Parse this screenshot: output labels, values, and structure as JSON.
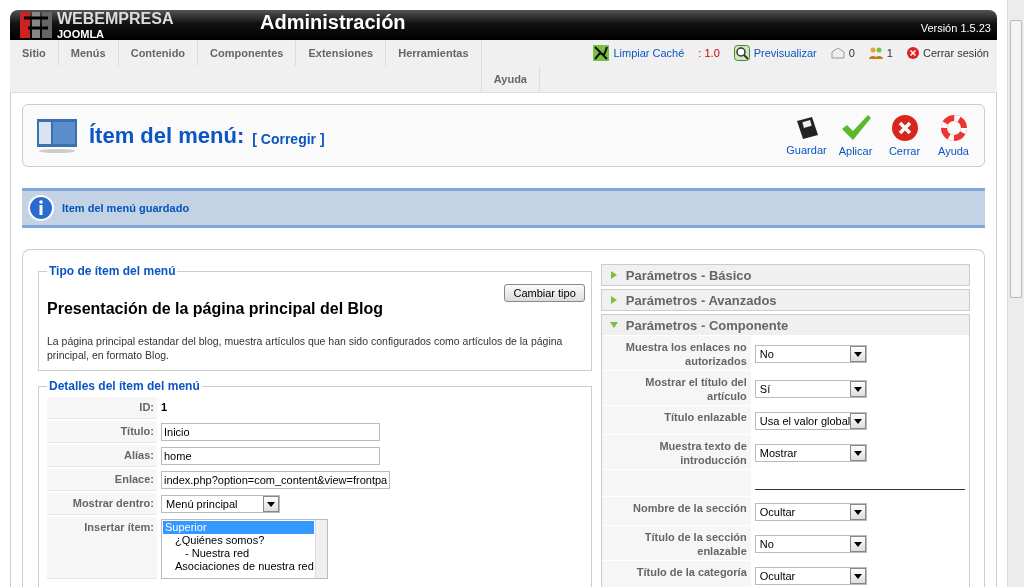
{
  "header": {
    "brand": "WEBEMPRESA",
    "brand_sub": "JOOMLA",
    "title": "Administración",
    "version": "Versión 1.5.23"
  },
  "menu": {
    "items": [
      "Sitio",
      "Menús",
      "Contenido",
      "Componentes",
      "Extensiones",
      "Herramientas",
      "Ayuda"
    ]
  },
  "status": [
    {
      "kind": "cache",
      "text": "Limpiar Caché"
    },
    {
      "kind": "version",
      "text": ": 1.0"
    },
    {
      "kind": "preview",
      "text": "Previsualizar"
    },
    {
      "kind": "messages",
      "text": "0"
    },
    {
      "kind": "users",
      "text": "1"
    },
    {
      "kind": "logout",
      "text": "Cerrar sesión"
    }
  ],
  "toolbar": {
    "title": "Ítem del menú:",
    "subtitle": "[ Corregir ]",
    "buttons": [
      {
        "kind": "save",
        "label": "Guardar"
      },
      {
        "kind": "apply",
        "label": "Aplicar"
      },
      {
        "kind": "close",
        "label": "Cerrar"
      },
      {
        "kind": "help",
        "label": "Ayuda"
      }
    ]
  },
  "message": "Item del menú guardado",
  "type_section": {
    "legend": "Tipo de ítem del menú",
    "button": "Cambiar tipo",
    "heading": "Presentación de la página principal del Blog",
    "description": "La página principal estandar del blog, muestra artículos que han sido configurados como artículos de la página principal, en formato Blog."
  },
  "details": {
    "legend": "Detalles del ítem del menú",
    "rows": [
      {
        "kind": "text",
        "label": "ID:",
        "value": "1"
      },
      {
        "kind": "input",
        "label": "Título:",
        "value": "Inicio"
      },
      {
        "kind": "input",
        "label": "Alías:",
        "value": "home"
      },
      {
        "kind": "input",
        "label": "Enlace:",
        "value": "index.php?option=com_content&view=frontpa"
      },
      {
        "kind": "select",
        "label": "Mostrar dentro:",
        "value": "Menú principal"
      },
      {
        "kind": "list",
        "label": "Insertar ítem:",
        "options": [
          {
            "text": "Superior",
            "selected": true,
            "children": [
              {
                "text": "¿Quiénes somos?",
                "selected": false,
                "children": [
                  {
                    "text": "- Nuestra red",
                    "selected": false
                  }
                ]
              },
              {
                "text": "Asociaciones de nuestra red",
                "selected": false
              }
            ]
          }
        ]
      }
    ]
  },
  "params": {
    "panels": [
      {
        "title": "Parámetros - Básico",
        "expanded": false
      },
      {
        "title": "Parámetros - Avanzados",
        "expanded": false
      },
      {
        "title": "Parámetros - Componente",
        "expanded": true,
        "rows": [
          {
            "kind": "select",
            "label": "Muestra los enlaces no autorizados",
            "value": "No"
          },
          {
            "kind": "select",
            "label": "Mostrar el título del artículo",
            "value": "Sí"
          },
          {
            "kind": "select",
            "label": "Título enlazable",
            "value": "Usa el valor global"
          },
          {
            "kind": "select",
            "label": "Muestra texto de introducción",
            "value": "Mostrar"
          },
          {
            "kind": "separator"
          },
          {
            "kind": "select",
            "label": "Nombre de la sección",
            "value": "Ocultar"
          },
          {
            "kind": "select",
            "label": "Título de la sección enlazable",
            "value": "No"
          },
          {
            "kind": "select",
            "label": "Título de la categoría",
            "value": "Ocultar"
          }
        ]
      }
    ]
  }
}
